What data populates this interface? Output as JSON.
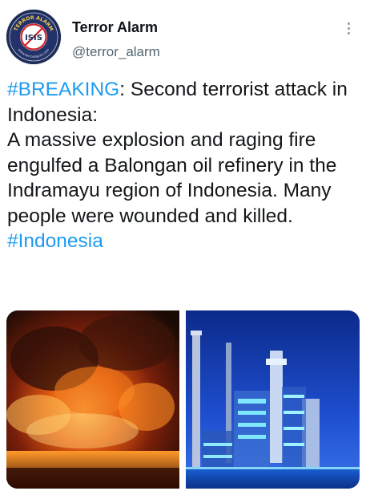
{
  "author": {
    "display_name": "Terror Alarm",
    "handle": "@terror_alarm",
    "avatar": {
      "icon": "terror-alarm-logo",
      "ring_text_top": "TERROR ALARM",
      "ring_text_bottom": "www.terroralarm.com",
      "center_text": "ISIS"
    }
  },
  "menu": {
    "icon": "more-vertical-icon"
  },
  "tweet": {
    "breaking_tag": "#BREAKING",
    "line1": ": Second terrorist attack in Indonesia:",
    "body": "A massive explosion and raging fire engulfed a Balongan oil refinery in the Indramayu region of Indonesia. Many people were wounded and killed.",
    "footer_tag": "#Indonesia"
  },
  "media": [
    {
      "kind": "photo",
      "subject": "refinery-fire-photo"
    },
    {
      "kind": "photo",
      "subject": "oil-refinery-night-photo"
    }
  ],
  "colors": {
    "hashtag": "#1d9bf0",
    "text": "#14171a",
    "handle": "#536471"
  }
}
